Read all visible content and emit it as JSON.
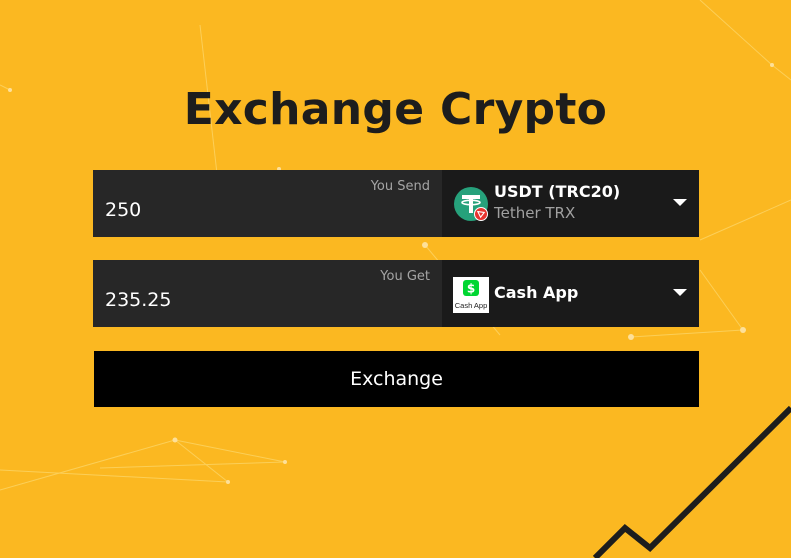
{
  "page": {
    "title": "Exchange Crypto"
  },
  "send": {
    "label": "You Send",
    "amount": "250",
    "currency": {
      "name": "USDT (TRC20)",
      "sub": "Tether TRX",
      "icon": "tether-icon",
      "color": "#26A17B"
    }
  },
  "get": {
    "label": "You Get",
    "amount": "235.25",
    "currency": {
      "name": "Cash App",
      "icon": "cash-app-icon",
      "icon_text": "Cash App",
      "color": "#00D632"
    }
  },
  "exchange_button": {
    "label": "Exchange"
  }
}
